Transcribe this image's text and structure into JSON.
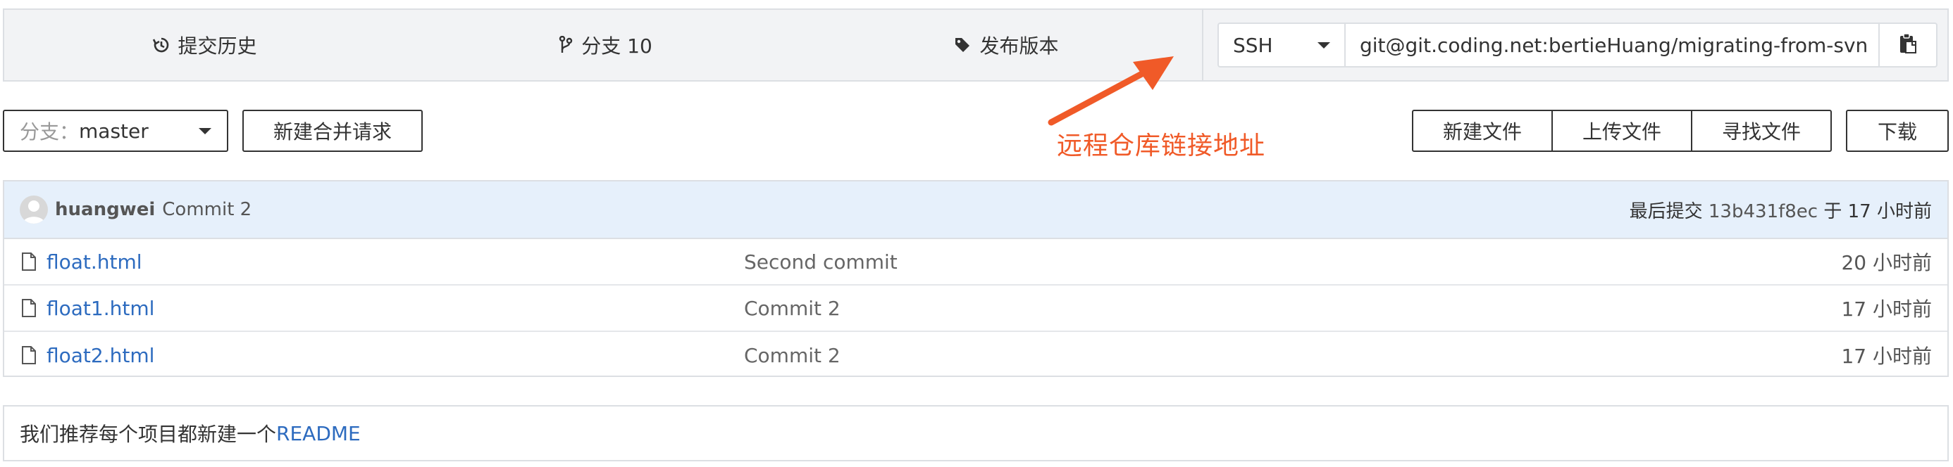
{
  "topbar": {
    "history_label": "提交历史",
    "branches_label": "分支 10",
    "releases_label": "发布版本",
    "clone": {
      "protocol": "SSH",
      "url": "git@git.coding.net:bertieHuang/migrating-from-svn"
    }
  },
  "toolbar": {
    "branch_prefix": "分支：",
    "branch_name": "master",
    "new_merge_request": "新建合并请求",
    "new_file": "新建文件",
    "upload_file": "上传文件",
    "find_file": "寻找文件",
    "download": "下载"
  },
  "annotation": {
    "text": "远程仓库链接地址",
    "color": "#f05a28"
  },
  "last_commit": {
    "author": "huangwei",
    "message": "Commit 2",
    "prefix": "最后提交",
    "hash": "13b431f8ec",
    "connector": "于",
    "time": "17 小时前"
  },
  "files": [
    {
      "name": "float.html",
      "message": "Second commit",
      "time": "20 小时前"
    },
    {
      "name": "float1.html",
      "message": "Commit 2",
      "time": "17 小时前"
    },
    {
      "name": "float2.html",
      "message": "Commit 2",
      "time": "17 小时前"
    }
  ],
  "readme": {
    "text": "我们推荐每个项目都新建一个",
    "link": "README"
  },
  "colors": {
    "link": "#2d6bbf",
    "header_bg": "#e6f0fb",
    "annotation": "#f05a28"
  }
}
